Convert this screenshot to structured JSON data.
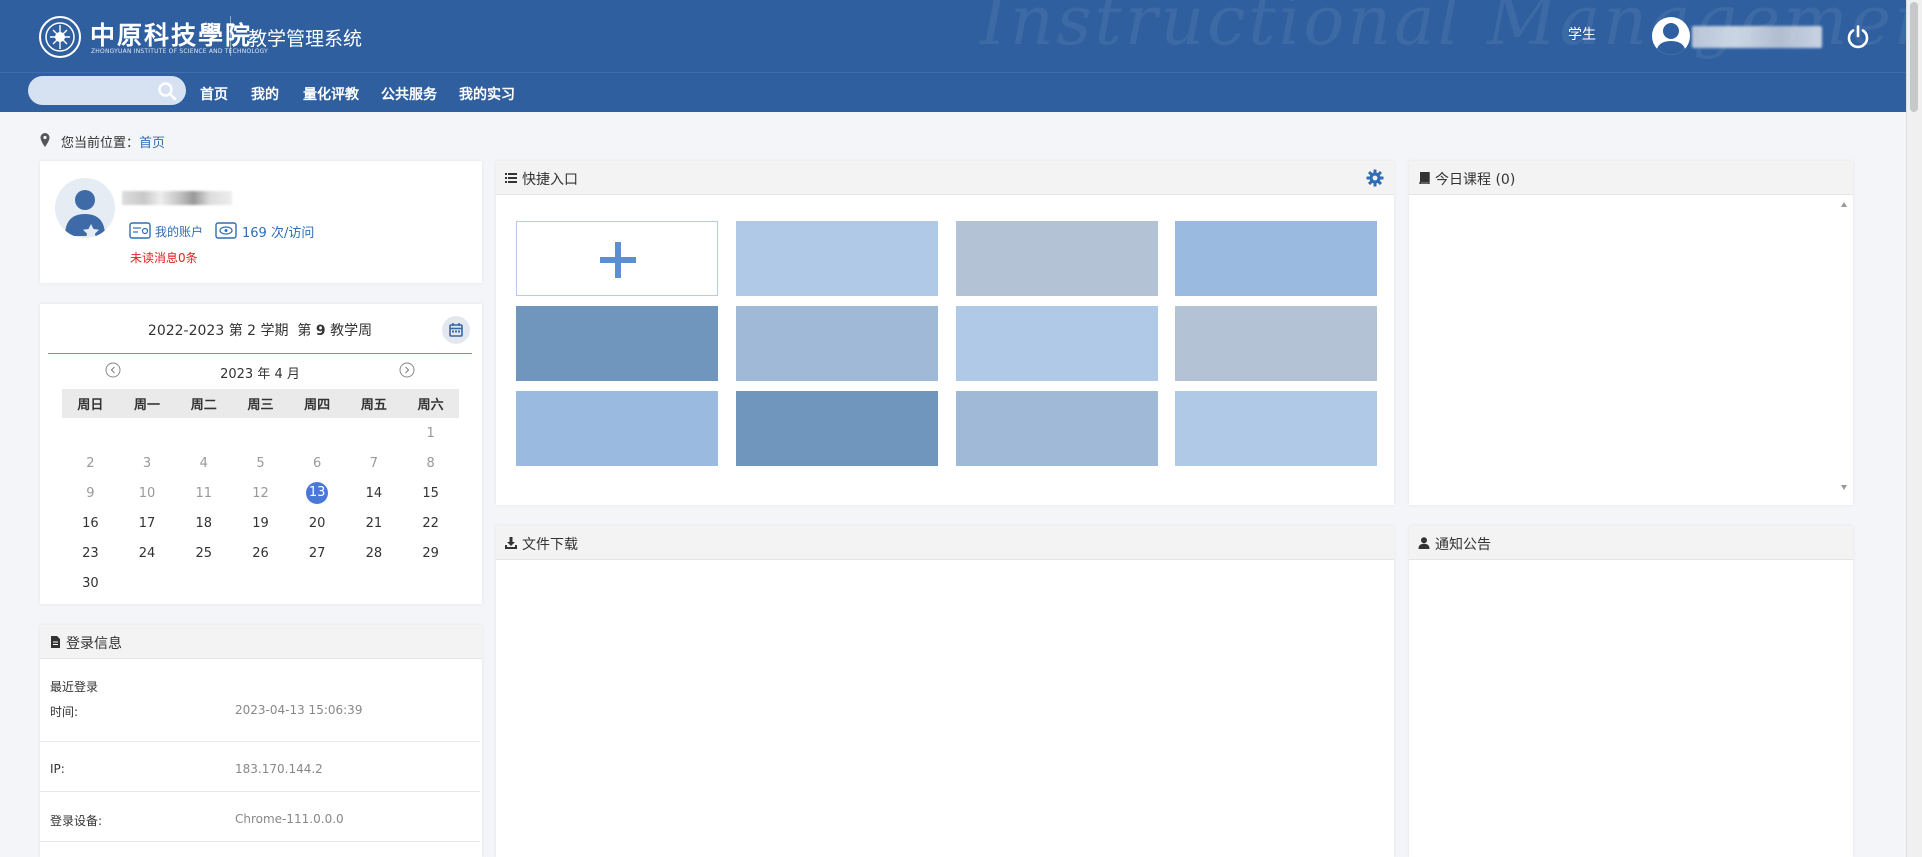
{
  "header": {
    "logo_cn": "中原科技學院",
    "logo_en": "ZHONGYUAN INSTITUTE OF SCIENCE AND TECHNOLOGY",
    "system_title": "教学管理系统",
    "watermark": "Instructional Management System",
    "role": "学生"
  },
  "nav": {
    "search_placeholder": "",
    "items": [
      "首页",
      "我的",
      "量化评教",
      "公共服务",
      "我的实习"
    ]
  },
  "breadcrumb": {
    "label": "您当前位置：",
    "current": "首页"
  },
  "profile": {
    "account_label": "我的账户",
    "visits": "169 次/访问",
    "unread": "未读消息0条"
  },
  "calendar": {
    "year_range": "2022-2023",
    "term_prefix": "第",
    "term": "2",
    "term_suffix": "学期",
    "week_prefix": "第",
    "week": "9",
    "week_suffix": "教学周",
    "month_label": "2023 年 4 月",
    "weekdays": [
      "周日",
      "周一",
      "周二",
      "周三",
      "周四",
      "周五",
      "周六"
    ],
    "today": "13",
    "weeks": [
      [
        "",
        "",
        "",
        "",
        "",
        "",
        "1"
      ],
      [
        "2",
        "3",
        "4",
        "5",
        "6",
        "7",
        "8"
      ],
      [
        "9",
        "10",
        "11",
        "12",
        "13",
        "14",
        "15"
      ],
      [
        "16",
        "17",
        "18",
        "19",
        "20",
        "21",
        "22"
      ],
      [
        "23",
        "24",
        "25",
        "26",
        "27",
        "28",
        "29"
      ],
      [
        "30",
        "",
        "",
        "",
        "",
        "",
        ""
      ]
    ],
    "past_through": 12
  },
  "login_info": {
    "title": "登录信息",
    "section": "最近登录",
    "time_label": "时间:",
    "time_value": "2023-04-13 15:06:39",
    "ip_label": "IP:",
    "ip_value": "183.170.144.2",
    "device_label": "登录设备:",
    "device_value": "Chrome-111.0.0.0"
  },
  "quick_access": {
    "title": "快捷入口",
    "tile_colors": [
      "#afc9e7",
      "#b4c2d5",
      "#9bbadf",
      "#7196bd",
      "#a0b9d6",
      "#afc9e7",
      "#b4c2d5",
      "#9bbadf",
      "#7196bd",
      "#a0b9d6",
      "#afc9e7"
    ]
  },
  "today_courses": {
    "title": "今日课程 (0)"
  },
  "file_download": {
    "title": "文件下载"
  },
  "notices": {
    "title": "通知公告"
  },
  "colors": {
    "header": "#2f5f9f",
    "accent": "#2f6db5",
    "today": "#4a78d8",
    "unread": "#e02020"
  }
}
